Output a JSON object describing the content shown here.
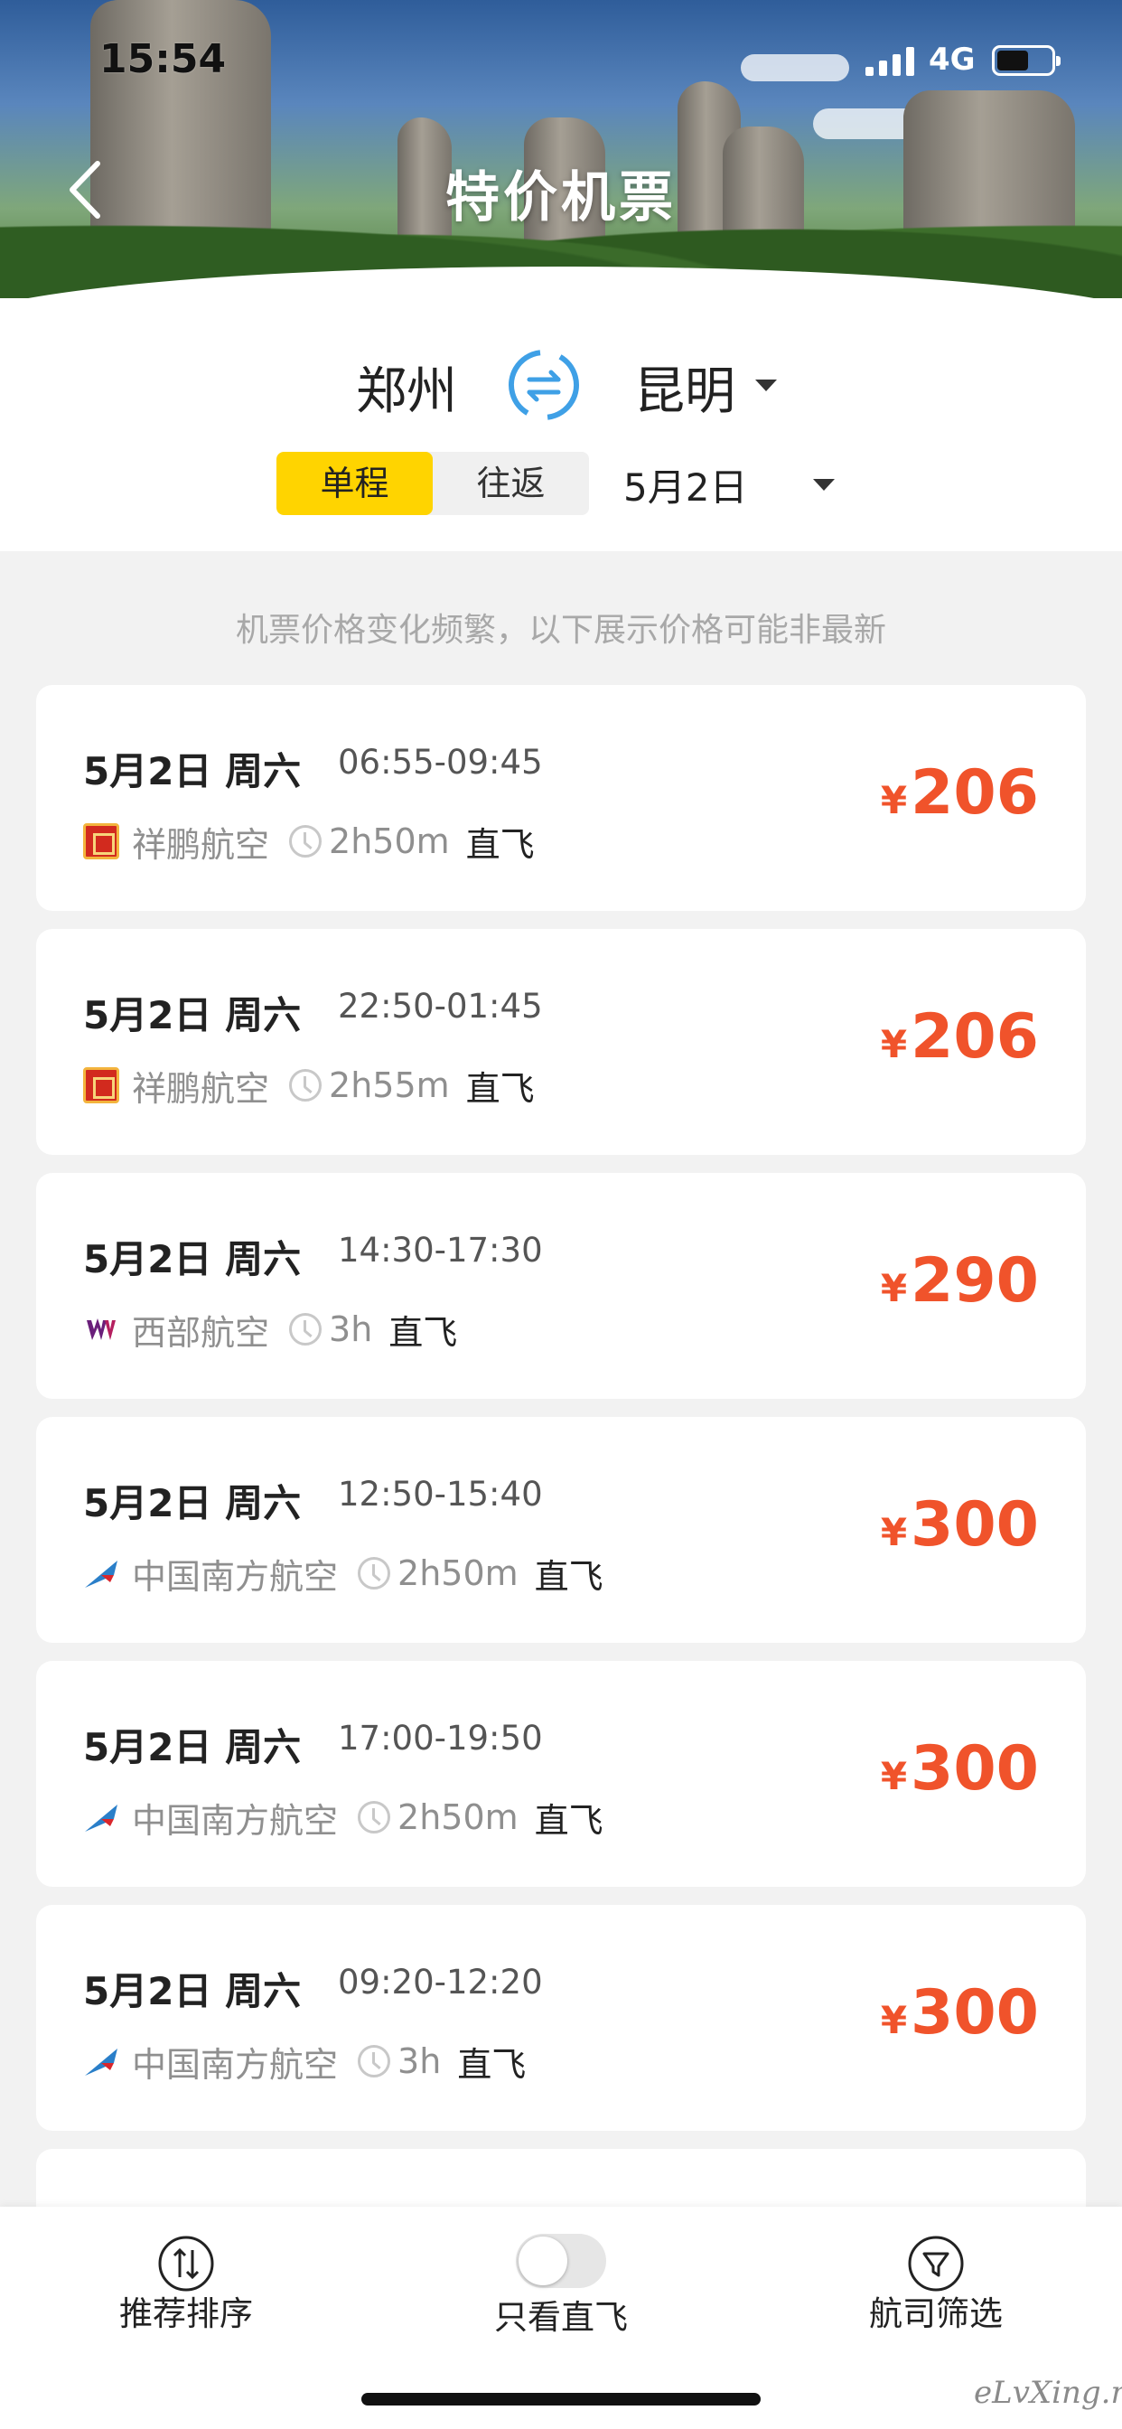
{
  "status_bar": {
    "time": "15:54",
    "network": "4G"
  },
  "header": {
    "title": "特价机票"
  },
  "search": {
    "from_city": "郑州",
    "to_city": "昆明",
    "trip_types": [
      {
        "label": "单程",
        "active": true
      },
      {
        "label": "往返",
        "active": false
      }
    ],
    "date": "5月2日"
  },
  "notice": "机票价格变化频繁，以下展示价格可能非最新",
  "flights": [
    {
      "day": "5月2日 周六",
      "times": "06:55-09:45",
      "airline": "祥鹏航空",
      "logo": "xiangpeng-logo-icon",
      "duration": "2h50m",
      "type": "直飞",
      "currency": "¥",
      "price": "206"
    },
    {
      "day": "5月2日 周六",
      "times": "22:50-01:45",
      "airline": "祥鹏航空",
      "logo": "xiangpeng-logo-icon",
      "duration": "2h55m",
      "type": "直飞",
      "currency": "¥",
      "price": "206"
    },
    {
      "day": "5月2日 周六",
      "times": "14:30-17:30",
      "airline": "西部航空",
      "logo": "west-air-logo-icon",
      "duration": "3h",
      "type": "直飞",
      "currency": "¥",
      "price": "290"
    },
    {
      "day": "5月2日 周六",
      "times": "12:50-15:40",
      "airline": "中国南方航空",
      "logo": "china-southern-logo-icon",
      "duration": "2h50m",
      "type": "直飞",
      "currency": "¥",
      "price": "300"
    },
    {
      "day": "5月2日 周六",
      "times": "17:00-19:50",
      "airline": "中国南方航空",
      "logo": "china-southern-logo-icon",
      "duration": "2h50m",
      "type": "直飞",
      "currency": "¥",
      "price": "300"
    },
    {
      "day": "5月2日 周六",
      "times": "09:20-12:20",
      "airline": "中国南方航空",
      "logo": "china-southern-logo-icon",
      "duration": "3h",
      "type": "直飞",
      "currency": "¥",
      "price": "300"
    }
  ],
  "bottom_bar": {
    "sort_label": "推荐排序",
    "direct_only_label": "只看直飞",
    "direct_only_enabled": false,
    "airline_filter_label": "航司筛选"
  },
  "watermark": "eLvXing.net",
  "colors": {
    "accent_yellow": "#ffd400",
    "price_red": "#f0532b",
    "swap_blue": "#3fa0e6"
  }
}
